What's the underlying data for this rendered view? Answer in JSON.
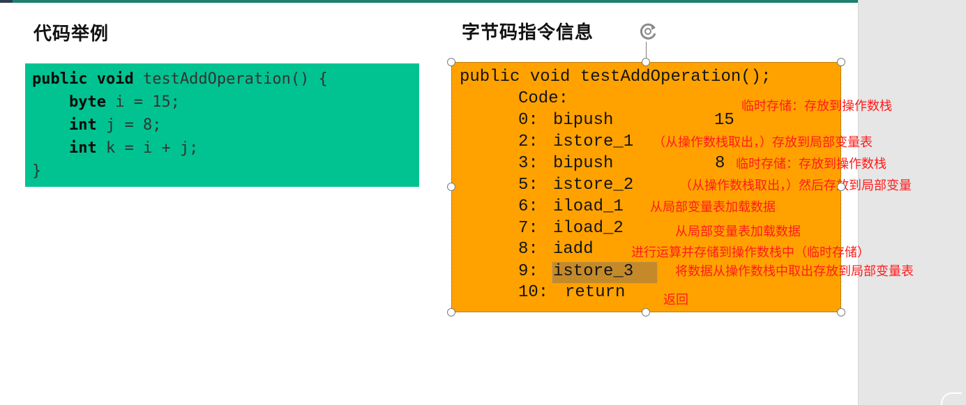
{
  "left_heading": "代码举例",
  "right_heading": "字节码指令信息",
  "java_code": {
    "line1": {
      "kw": "public void",
      "rest": " testAddOperation() {"
    },
    "line2": {
      "indent": "    ",
      "kw": "byte",
      "rest": " i = 15;"
    },
    "line3": {
      "indent": "    ",
      "kw": "int",
      "rest": " j = 8;"
    },
    "line4": {
      "indent": "    ",
      "kw": "int",
      "rest": " k = i + j;"
    },
    "line5": "}"
  },
  "bytecode": {
    "signature": "public void testAddOperation();",
    "code_label": "Code:",
    "lines": [
      {
        "idx": "0:",
        "op": "bipush",
        "arg": "15"
      },
      {
        "idx": "2:",
        "op": "istore_1",
        "arg": ""
      },
      {
        "idx": "3:",
        "op": "bipush",
        "arg": "8"
      },
      {
        "idx": "5:",
        "op": "istore_2",
        "arg": ""
      },
      {
        "idx": "6:",
        "op": "iload_1",
        "arg": ""
      },
      {
        "idx": "7:",
        "op": "iload_2",
        "arg": ""
      },
      {
        "idx": "8:",
        "op": "iadd",
        "arg": ""
      },
      {
        "idx": "9:",
        "op": "istore_3",
        "arg": ""
      },
      {
        "idx": "10:",
        "op": "return",
        "arg": ""
      }
    ]
  },
  "notes": {
    "n0": "临时存储：存放到操作数栈",
    "n2": "（从操作数栈取出，）存放到局部变量表",
    "n3": "临时存储：存放到操作数栈",
    "n5": "（从操作数栈取出，）然后存放到局部变量",
    "n6": "从局部变量表加载数据",
    "n7": "从局部变量表加载数据",
    "n8": "进行运算并存储到操作数栈中（临时存储）",
    "n9": "将数据从操作数栈中取出存放到局部变量表",
    "n10": "返回"
  },
  "colors": {
    "code_box": "#00c391",
    "bytecode_box": "#ffa200",
    "annotation": "#ff1b1b",
    "highlight": "#c48a2a"
  },
  "icons": {
    "rotate": "rotate-handle-icon"
  }
}
